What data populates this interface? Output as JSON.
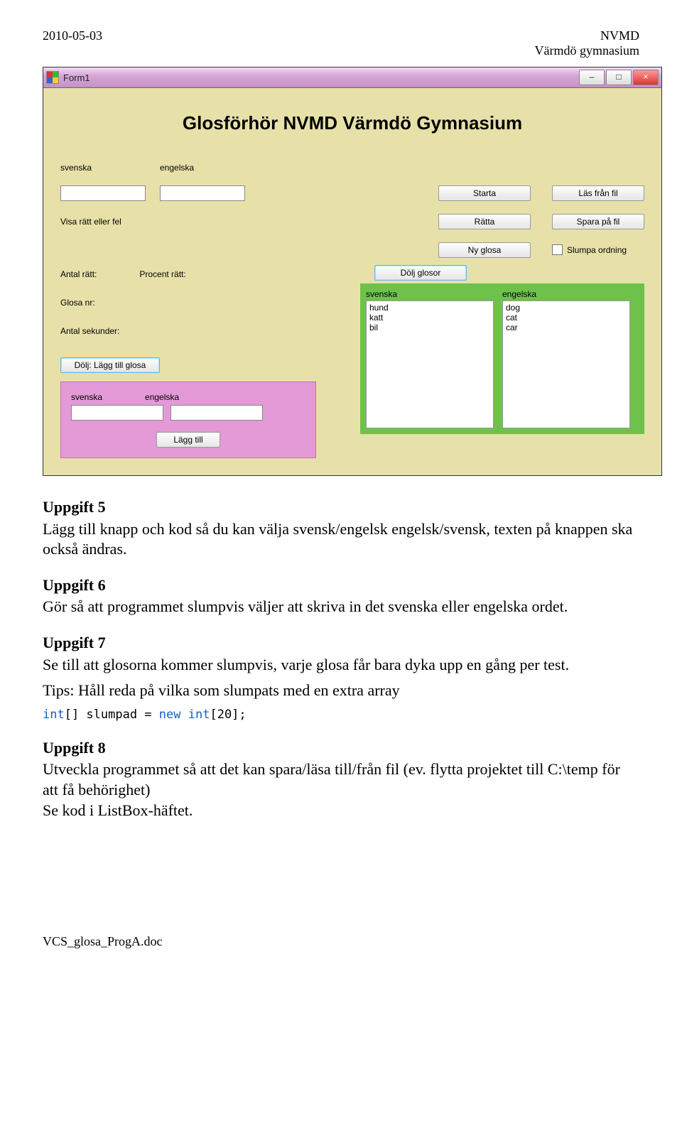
{
  "doc": {
    "date": "2010-05-03",
    "org_line1": "NVMD",
    "org_line2": "Värmdö gymnasium",
    "footer": "VCS_glosa_ProgA.doc"
  },
  "window": {
    "title": "Form1",
    "min": "–",
    "max": "□",
    "close": "×"
  },
  "app": {
    "title": "Glosförhör NVMD Värmdö Gymnasium",
    "lbl_svenska": "svenska",
    "lbl_engelska": "engelska",
    "lbl_visaresultat": "Visa rätt eller fel",
    "btn_starta": "Starta",
    "btn_ratta": "Rätta",
    "btn_nyglosa": "Ny glosa",
    "btn_lasfranfil": "Läs från fil",
    "btn_sparafil": "Spara på fil",
    "chk_slumpa": "Slumpa ordning",
    "lbl_antal_ratt": "Antal rätt:",
    "lbl_procent_ratt": "Procent rätt:",
    "lbl_glosa_nr": "Glosa nr:",
    "lbl_antal_sek": "Antal sekunder:",
    "btn_dolj_lagg": "Dölj: Lägg till glosa",
    "btn_dolj_glosor": "Dölj glosor",
    "pink": {
      "lbl_sv": "svenska",
      "lbl_en": "engelska",
      "btn_lagg": "Lägg till"
    },
    "green": {
      "lbl_sv": "svenska",
      "lbl_en": "engelska",
      "list_sv": "hund\nkatt\nbil",
      "list_en": "dog\ncat\ncar"
    }
  },
  "tasks": {
    "u5_h": "Uppgift 5",
    "u5_p": "Lägg till knapp och kod så du kan välja svensk/engelsk engelsk/svensk, texten på knappen ska också ändras.",
    "u6_h": "Uppgift 6",
    "u6_p": "Gör så att programmet slumpvis väljer att skriva in det svenska eller engelska ordet.",
    "u7_h": "Uppgift 7",
    "u7_p1": "Se till att glosorna kommer slumpvis, varje glosa får bara dyka upp en gång per test.",
    "u7_p2": "Tips: Håll reda på vilka som slumpats med en extra array",
    "u7_code_kw1": "int",
    "u7_code_rest1": "[] slumpad = ",
    "u7_code_kw2": "new",
    "u7_code_rest2": " ",
    "u7_code_ty": "int",
    "u7_code_rest3": "[20];",
    "u8_h": "Uppgift 8",
    "u8_p": "Utveckla programmet så att det kan spara/läsa till/från fil (ev. flytta projektet till C:\\temp för att få behörighet)\nSe kod i ListBox-häftet."
  }
}
